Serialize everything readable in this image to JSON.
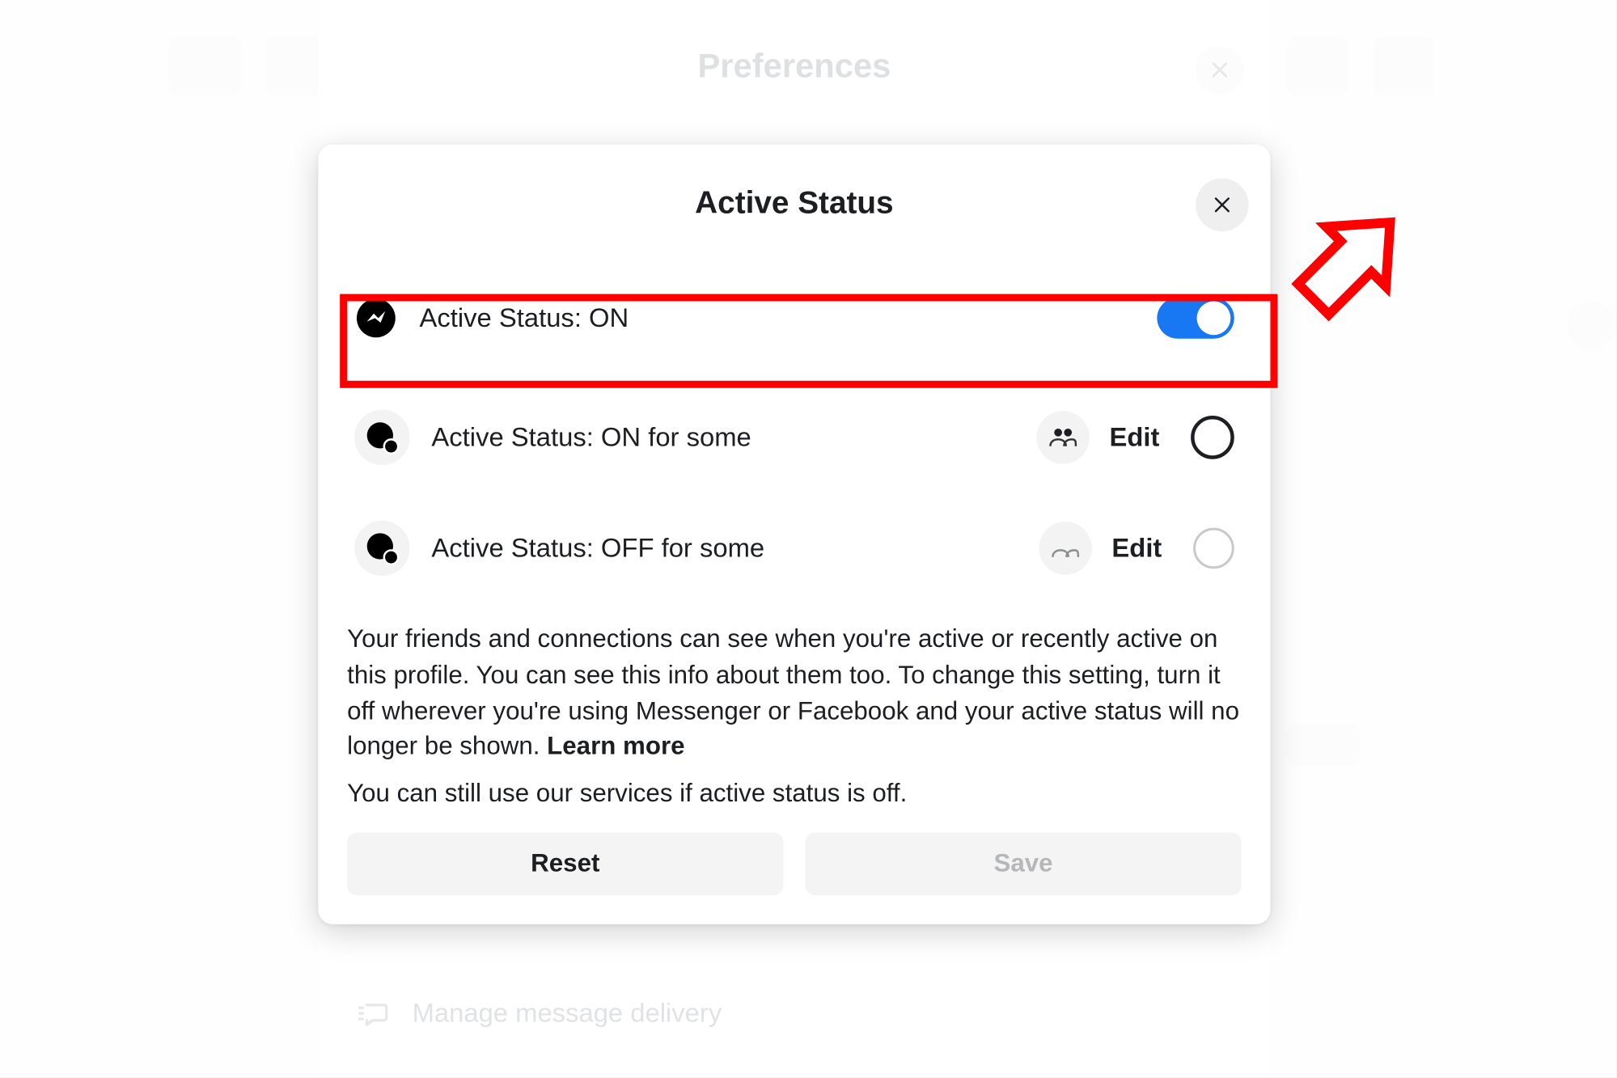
{
  "background": {
    "preferences_title": "Preferences",
    "manage_delivery": "Manage message delivery"
  },
  "modal": {
    "title": "Active Status",
    "rows": {
      "on": {
        "label": "Active Status: ON"
      },
      "on_some": {
        "label": "Active Status: ON for some",
        "edit": "Edit"
      },
      "off_some": {
        "label": "Active Status: OFF for some",
        "edit": "Edit"
      }
    },
    "description": "Your friends and connections can see when you're active or recently active on this profile. You can see this info about them too. To change this setting, turn it off wherever you're using Messenger or Facebook and your active status will no longer be shown.",
    "learn_more": "Learn more",
    "description2": "You can still use our services if active status is off.",
    "buttons": {
      "reset": "Reset",
      "save": "Save"
    }
  },
  "annotation": {
    "highlight_color": "#ff0000"
  }
}
